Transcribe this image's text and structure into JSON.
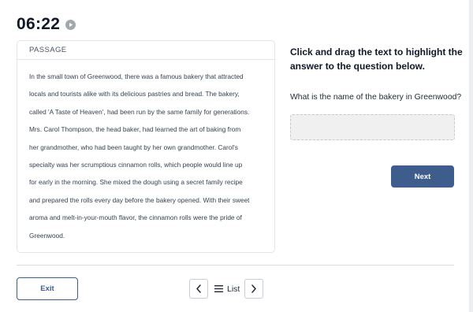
{
  "timer": {
    "value": "06:22"
  },
  "passage": {
    "header": "PASSAGE",
    "lines": [
      "In the small town of Greenwood, there was a famous bakery that attracted",
      "locals and tourists alike with its delicious pastries and bread. The bakery,",
      "called 'A Taste of Heaven', had been run by the same family for generations.",
      "Mrs. Carol Thompson, the head baker, had learned the art of baking from",
      "her grandmother, who had been taught by her own grandmother. Carol's",
      "specialty was her scrumptious cinnamon rolls, which people would line up",
      "for early in the morning. She mixed the dough using a secret family recipe",
      "and prepared the rolls every day before the bakery opened. With their sweet",
      "aroma and melt-in-your-mouth flavor, the cinnamon rolls were the pride of",
      "Greenwood."
    ]
  },
  "question_panel": {
    "instruction": "Click and drag the text to highlight the answer to the question below.",
    "question": "What is the name of the bakery in Greenwood?",
    "answer": ""
  },
  "buttons": {
    "next": "Next",
    "exit": "Exit"
  },
  "footer": {
    "list_label": "List"
  },
  "colors": {
    "primary": "#3e5d8c",
    "answer_bg": "#f0f0f0",
    "border": "#e3e5e9"
  },
  "icons": {
    "timer": "play-circle-icon",
    "prev": "chevron-left-icon",
    "next": "chevron-right-icon",
    "list": "menu-icon"
  }
}
